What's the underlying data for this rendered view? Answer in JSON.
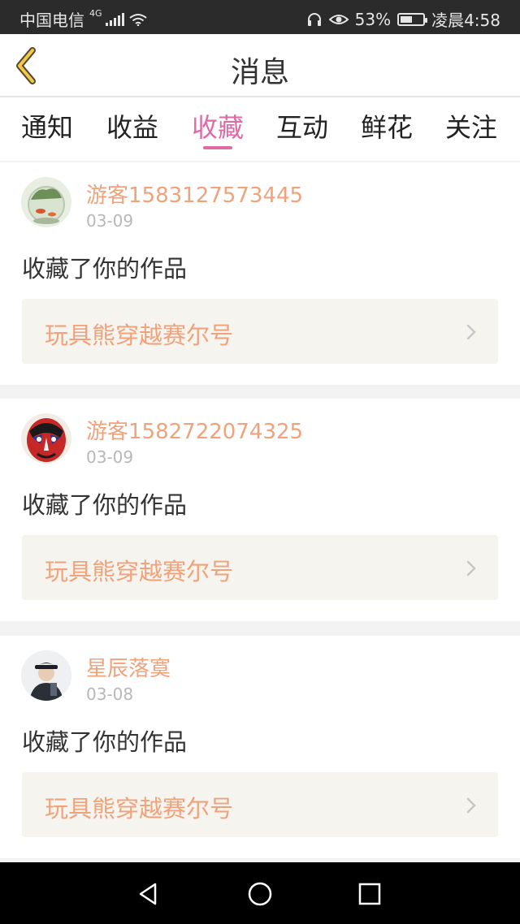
{
  "status_bar": {
    "carrier": "中国电信",
    "network": "4G",
    "battery_percent": "53%",
    "battery_level": 0.53,
    "time": "凌晨4:58",
    "icons": [
      "signal-icon",
      "wifi-icon",
      "headphone-icon",
      "eye-icon",
      "battery-icon"
    ]
  },
  "header": {
    "back_icon": "chevron-left-icon",
    "title": "消息"
  },
  "tabs": {
    "items": [
      {
        "label": "通知"
      },
      {
        "label": "收益"
      },
      {
        "label": "收藏"
      },
      {
        "label": "互动"
      },
      {
        "label": "鲜花"
      },
      {
        "label": "关注"
      }
    ],
    "active": "收藏",
    "active_color": "#e06aa6"
  },
  "colors": {
    "accent_orange": "#f0a27a",
    "card_tint": "#f6f4ee",
    "divider": "#f3f3f3"
  },
  "messages": [
    {
      "username": "游客1583127573445",
      "date": "03-09",
      "action": "收藏了你的作品",
      "work_title": "玩具熊穿越赛尔号",
      "avatar": "goldfish-bowl-avatar"
    },
    {
      "username": "游客1582722074325",
      "date": "03-09",
      "action": "收藏了你的作品",
      "work_title": "玩具熊穿越赛尔号",
      "avatar": "opera-mask-avatar"
    },
    {
      "username": "星辰落寞",
      "date": "03-08",
      "action": "收藏了你的作品",
      "work_title": "玩具熊穿越赛尔号",
      "avatar": "officer-avatar"
    }
  ],
  "nav_bar": {
    "icons": [
      "back-triangle-icon",
      "home-circle-icon",
      "recents-square-icon"
    ]
  }
}
